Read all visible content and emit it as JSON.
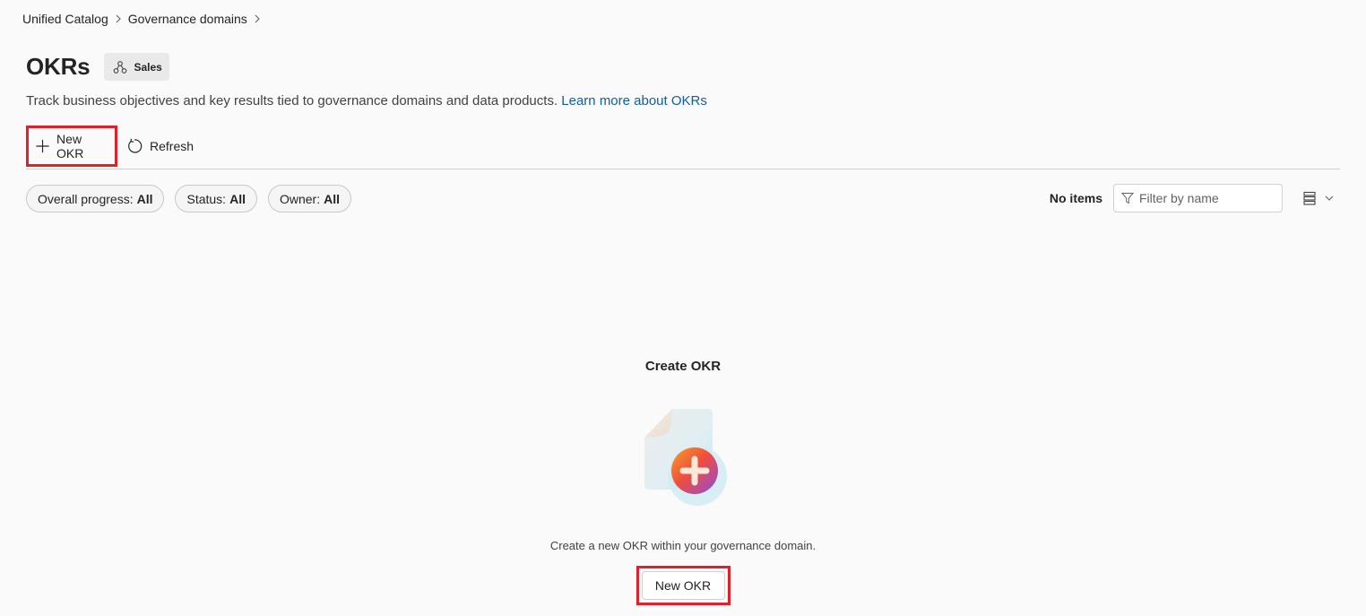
{
  "breadcrumb": {
    "items": [
      "Unified Catalog",
      "Governance domains"
    ]
  },
  "header": {
    "title": "OKRs",
    "domain_chip": "Sales",
    "description": "Track business objectives and key results tied to governance domains and data products.",
    "learn_more": "Learn more about OKRs"
  },
  "toolbar": {
    "new_label": "New OKR",
    "refresh_label": "Refresh"
  },
  "filters": {
    "progress": {
      "label": "Overall progress:",
      "value": "All"
    },
    "status": {
      "label": "Status:",
      "value": "All"
    },
    "owner": {
      "label": "Owner:",
      "value": "All"
    }
  },
  "list": {
    "count_text": "No items",
    "filter_placeholder": "Filter by name"
  },
  "empty_state": {
    "title": "Create OKR",
    "description": "Create a new OKR within your governance domain.",
    "button_label": "New OKR"
  },
  "colors": {
    "link": "#115ea3",
    "highlight": "#e3202a"
  }
}
